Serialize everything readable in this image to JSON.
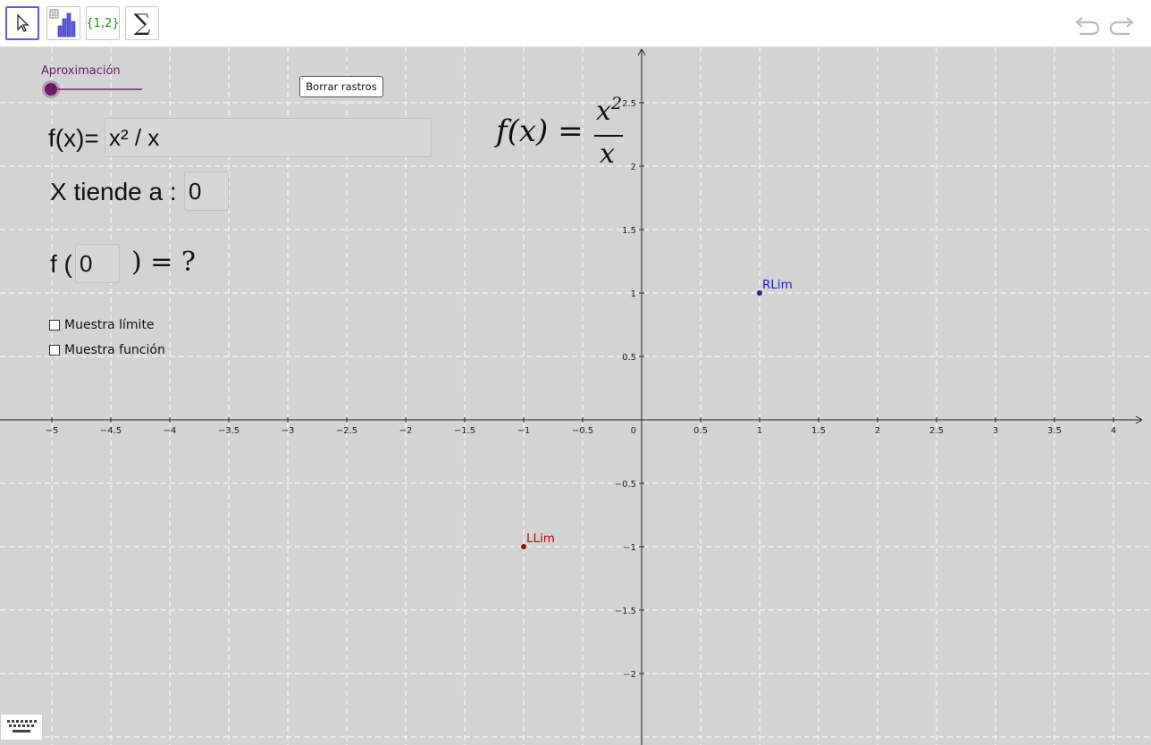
{
  "toolbar": {
    "tools": [
      {
        "name": "move-tool",
        "icon": "cursor-arrow-icon",
        "active": true
      },
      {
        "name": "statistics-tool",
        "icon": "bar-chart-icon",
        "active": false
      },
      {
        "name": "set-tool",
        "icon": "set-braces-icon",
        "label": "{1,2}",
        "active": false
      },
      {
        "name": "sum-tool",
        "icon": "sigma-icon",
        "label": "∑",
        "active": false
      }
    ],
    "undo_icon": "undo-icon",
    "redo_icon": "redo-icon"
  },
  "graphics": {
    "slider": {
      "label": "Aproximación",
      "value_fraction": 0.0,
      "color": "#6b1a6b"
    },
    "clear_traces_button": "Borrar rastros",
    "function_input": {
      "prefix": "f(x)=",
      "value": "x² / x"
    },
    "formula_display": {
      "lhs": "f(x) =",
      "numerator": "x",
      "exponent": "2",
      "denominator": "x"
    },
    "tends_to": {
      "label": "X tiende a :",
      "value": "0"
    },
    "evaluation": {
      "prefix": "f (",
      "value": "0",
      "suffix": ") = ?"
    },
    "checkboxes": [
      {
        "label": "Muestra límite",
        "checked": false
      },
      {
        "label": "Muestra función",
        "checked": false
      }
    ],
    "points": [
      {
        "label": "RLim",
        "x": 1,
        "y": 1,
        "color": "#1a1ae6"
      },
      {
        "label": "LLim",
        "x": -1,
        "y": -1,
        "color": "#cc0000"
      }
    ],
    "x_ticks": [
      "−5",
      "−4.5",
      "−4",
      "−3.5",
      "−3",
      "−2.5",
      "−2",
      "−1.5",
      "−1",
      "−0.5",
      "0",
      "0.5",
      "1",
      "1.5",
      "2",
      "2.5",
      "3",
      "3.5",
      "4"
    ],
    "y_ticks": [
      "2.5",
      "2",
      "1.5",
      "1",
      "0.5",
      "−0.5",
      "−1",
      "−1.5",
      "−2"
    ],
    "keyboard_icon": "keyboard-icon"
  }
}
